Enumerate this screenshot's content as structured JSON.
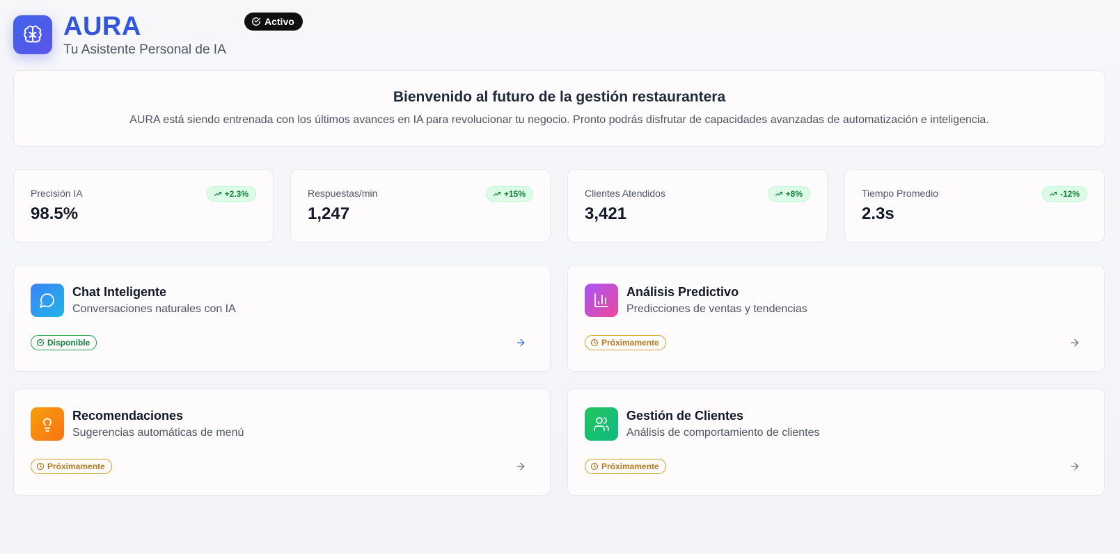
{
  "header": {
    "title": "AURA",
    "subtitle": "Tu Asistente Personal de IA",
    "status": "Activo",
    "logo_icon": "brain-icon"
  },
  "welcome": {
    "title": "Bienvenido al futuro de la gestión restaurantera",
    "text": "AURA está siendo entrenada con los últimos avances en IA para revolucionar tu negocio. Pronto podrás disfrutar de capacidades avanzadas de automatización e inteligencia."
  },
  "stats": [
    {
      "label": "Precisión IA",
      "value": "98.5%",
      "trend": "+2.3%"
    },
    {
      "label": "Respuestas/min",
      "value": "1,247",
      "trend": "+15%"
    },
    {
      "label": "Clientes Atendidos",
      "value": "3,421",
      "trend": "+8%"
    },
    {
      "label": "Tiempo Promedio",
      "value": "2.3s",
      "trend": "-12%"
    }
  ],
  "features": [
    {
      "title": "Chat Inteligente",
      "desc": "Conversaciones naturales con IA",
      "badge": "Disponible",
      "icon": "chat-icon",
      "color": "#3b82f6"
    },
    {
      "title": "Análisis Predictivo",
      "desc": "Predicciones de ventas y tendencias",
      "badge": "Próximamente",
      "icon": "bar-chart-icon",
      "color": "#a855f7"
    },
    {
      "title": "Recomendaciones",
      "desc": "Sugerencias automáticas de menú",
      "badge": "Próximamente",
      "icon": "lightbulb-icon",
      "color": "#f59e0b"
    },
    {
      "title": "Gestión de Clientes",
      "desc": "Análisis de comportamiento de clientes",
      "badge": "Próximamente",
      "icon": "users-icon",
      "color": "#22c55e"
    }
  ],
  "colors": {
    "brand": "#2f56dc",
    "success": "#15803d",
    "warning": "#b7791f"
  }
}
